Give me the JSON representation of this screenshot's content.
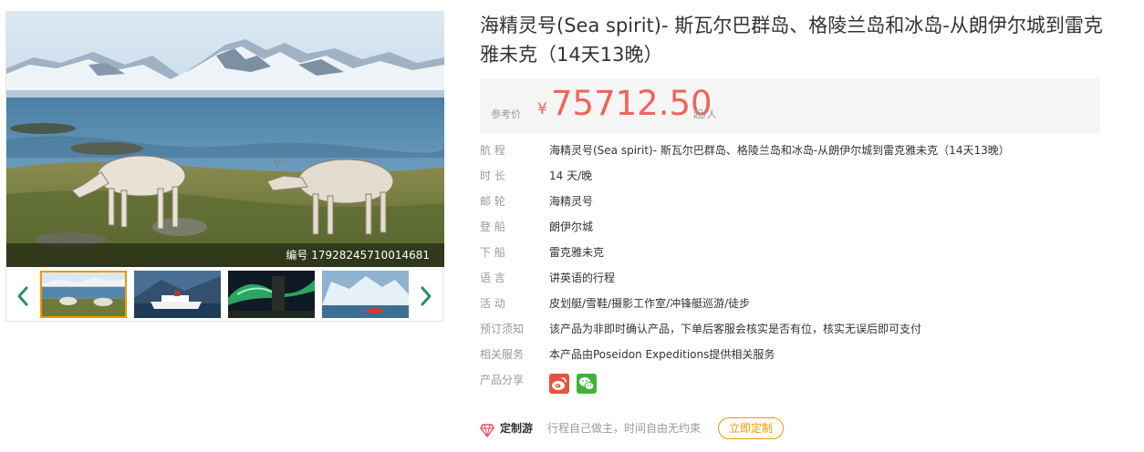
{
  "gallery": {
    "photo_code": "编号 17928245710014681",
    "prev_icon": "chevron-left-icon",
    "next_icon": "chevron-right-icon",
    "thumbnails": [
      "reindeer-tundra",
      "cruise-ship-fjord",
      "aurora-night",
      "icebergs-zodiac"
    ],
    "active_thumbnail": 0
  },
  "product": {
    "title": "海精灵号(Sea spirit)- 斯瓦尔巴群岛、格陵兰岛和冰岛-从朗伊尔城到雷克雅未克（14天13晚）",
    "price": {
      "label": "参考价",
      "currency": "¥",
      "value": "75712.50",
      "unit": "起/人",
      "color": "#f0645a"
    },
    "details": [
      {
        "label": "航  程",
        "value": "海精灵号(Sea spirit)- 斯瓦尔巴群岛、格陵兰岛和冰岛-从朗伊尔城到雷克雅未克（14天13晚）"
      },
      {
        "label": "时  长",
        "value": "14 天/晚"
      },
      {
        "label": "邮  轮",
        "value": "海精灵号"
      },
      {
        "label": "登  船",
        "value": "朗伊尔城"
      },
      {
        "label": "下  船",
        "value": "雷克雅未克"
      },
      {
        "label": "语  言",
        "value": "讲英语的行程"
      },
      {
        "label": "活  动",
        "value": "皮划艇/雪鞋/摄影工作室/冲锋艇巡游/徒步"
      },
      {
        "label": "预订须知",
        "value": "该产品为非即时确认产品，下单后客服会核实是否有位，核实无误后即可支付"
      },
      {
        "label": "相关服务",
        "value": "本产品由Poseidon Expeditions提供相关服务"
      },
      {
        "label": "产品分享",
        "value": ""
      }
    ],
    "share": {
      "weibo_icon": "weibo-icon",
      "wechat_icon": "wechat-icon",
      "weibo_color": "#e8533d",
      "wechat_color": "#3fb337"
    }
  },
  "custom_tour": {
    "icon": "diamond-icon",
    "title": "定制游",
    "description": "行程自己做主，时间自由无约束",
    "button": "立即定制",
    "accent": "#f39800"
  }
}
